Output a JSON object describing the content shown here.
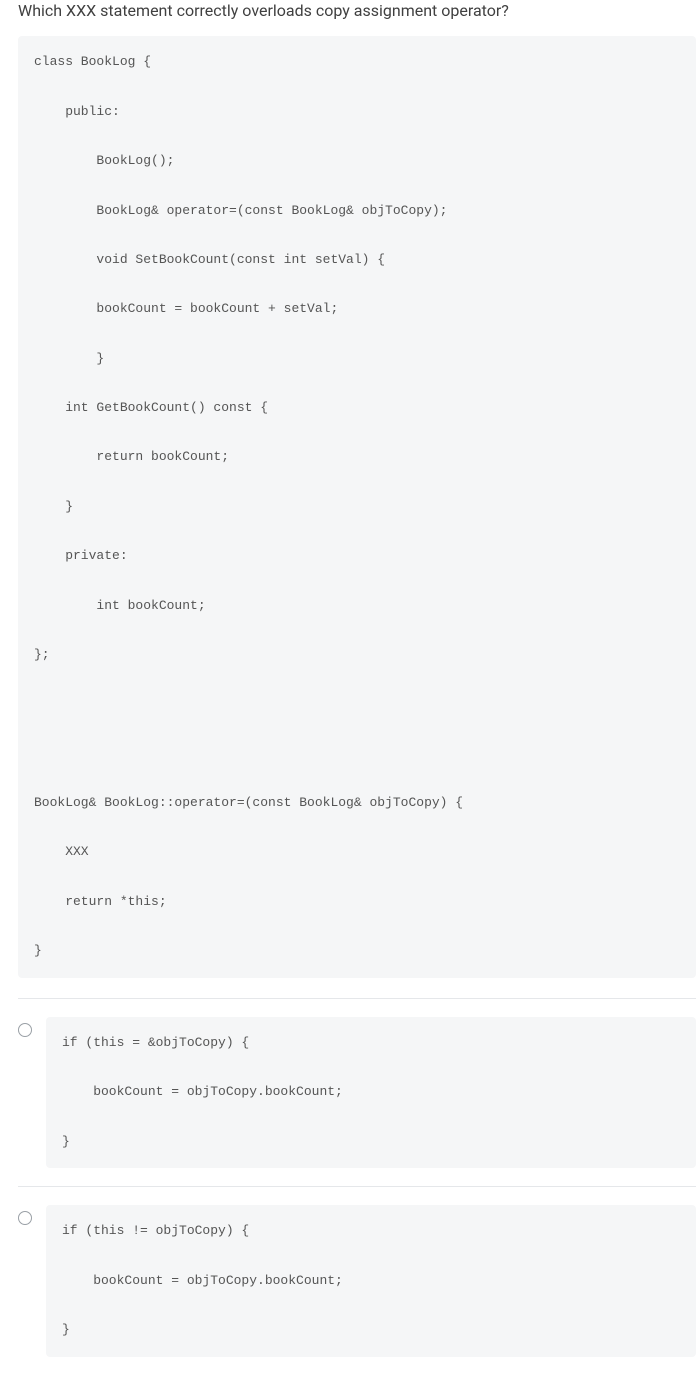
{
  "question": {
    "prompt": "Which XXX statement correctly overloads copy assignment operator?",
    "code": "class BookLog {\n\n    public:\n\n        BookLog();\n\n        BookLog& operator=(const BookLog& objToCopy);\n\n        void SetBookCount(const int setVal) {\n\n        bookCount = bookCount + setVal;\n\n        }\n\n    int GetBookCount() const {\n\n        return bookCount;\n\n    }\n\n    private:\n\n        int bookCount;\n\n};\n\n\n\n\n\nBookLog& BookLog::operator=(const BookLog& objToCopy) {\n\n    XXX\n\n    return *this;\n\n}"
  },
  "options": [
    {
      "code": "if (this = &objToCopy) {\n\n    bookCount = objToCopy.bookCount;\n\n}"
    },
    {
      "code": "if (this != objToCopy) {\n\n    bookCount = objToCopy.bookCount;\n\n}"
    }
  ]
}
